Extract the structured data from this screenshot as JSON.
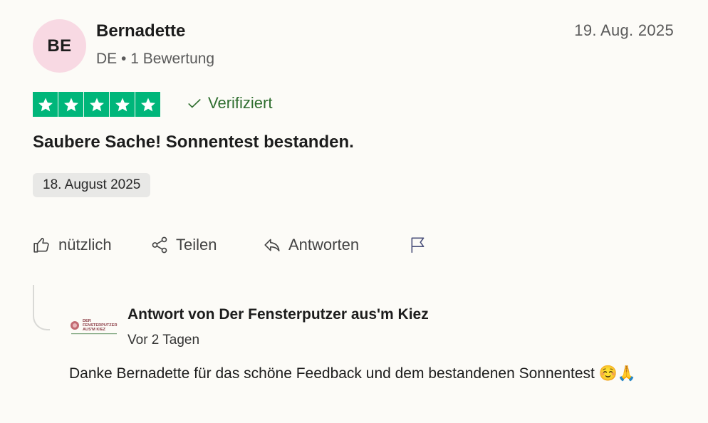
{
  "reviewer": {
    "initials": "BE",
    "name": "Bernadette",
    "meta": "DE • 1 Bewertung",
    "avatar_color": "#f8d9e3"
  },
  "review": {
    "date": "19. Aug. 2025",
    "rating": 5,
    "max_rating": 5,
    "star_color": "#00b67a",
    "verified_label": "Verifiziert",
    "title": "Saubere Sache! Sonnentest bestanden.",
    "experience_date": "18. August 2025"
  },
  "actions": {
    "useful_label": "nützlich",
    "share_label": "Teilen",
    "reply_label": "Antworten"
  },
  "reply": {
    "logo_text": [
      "DER",
      "FENSTERPUTZER",
      "AUS'M KIEZ"
    ],
    "title": "Antwort von Der Fensterputzer aus'm Kiez",
    "time": "Vor 2 Tagen",
    "text": "Danke Bernadette für das schöne Feedback und dem bestandenen Sonnentest ☺️🙏"
  }
}
